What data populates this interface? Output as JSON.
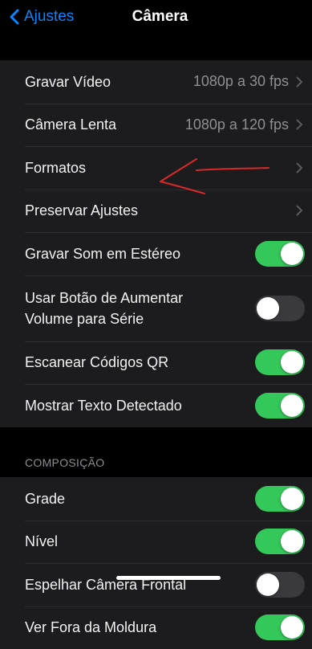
{
  "nav": {
    "back_label": "Ajustes",
    "title": "Câmera"
  },
  "group1": [
    {
      "label": "Gravar Vídeo",
      "value": "1080p a 30 fps"
    },
    {
      "label": "Câmera Lenta",
      "value": "1080p a 120 fps"
    },
    {
      "label": "Formatos"
    },
    {
      "label": "Preservar Ajustes"
    },
    {
      "label": "Gravar Som em Estéreo",
      "toggle": true
    },
    {
      "label_line1": "Usar Botão de Aumentar",
      "label_line2": "Volume para Série",
      "toggle": false
    },
    {
      "label": "Escanear Códigos QR",
      "toggle": true
    },
    {
      "label": "Mostrar Texto Detectado",
      "toggle": true
    }
  ],
  "section_header": "COMPOSIÇÃO",
  "group2": [
    {
      "label": "Grade",
      "toggle": true
    },
    {
      "label": "Nível",
      "toggle": true
    },
    {
      "label": "Espelhar Câmera Frontal",
      "toggle": false
    },
    {
      "label": "Ver Fora da Moldura",
      "toggle": true
    }
  ],
  "colors": {
    "accent": "#0a84ff",
    "toggle_on": "#34c759",
    "toggle_off": "#3a3a3c",
    "annotation": "#d62a2a"
  }
}
